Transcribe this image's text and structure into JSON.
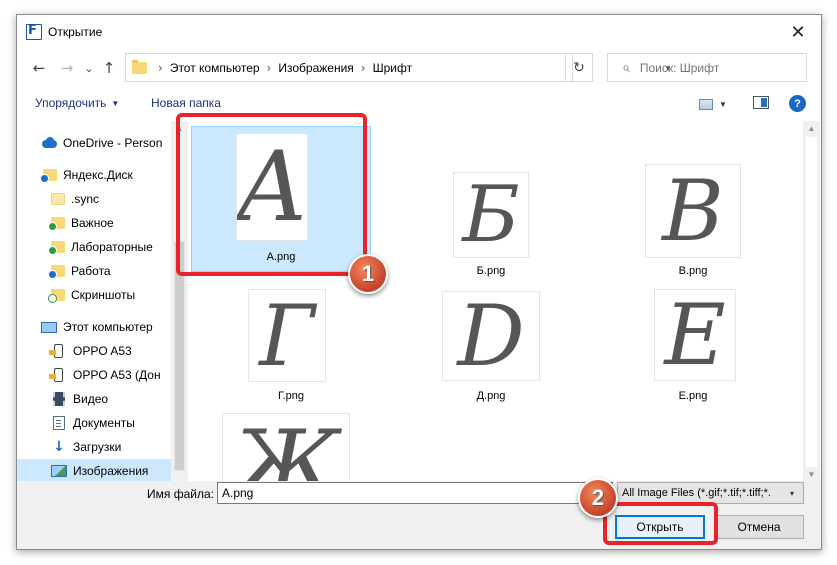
{
  "window": {
    "title": "Открытие",
    "close_label": "✕"
  },
  "nav": {
    "back": "←",
    "forward": "→",
    "recent": "⌄",
    "up": "↑",
    "breadcrumb": [
      "Этот компьютер",
      "Изображения",
      "Шрифт"
    ],
    "refresh": "↻",
    "search_placeholder": "Поиск: Шрифт",
    "search_icon": "⌕"
  },
  "toolbar": {
    "organize": "Упорядочить",
    "new_folder": "Новая папка",
    "help": "?"
  },
  "sidebar": {
    "items": [
      {
        "label": "OneDrive - Person",
        "icon": "onedrive-icon"
      },
      {
        "label": "Яндекс.Диск",
        "icon": "yandex-disk-icon"
      },
      {
        "label": ".sync",
        "icon": "folder-icon"
      },
      {
        "label": "Важное",
        "icon": "folder-synced-icon"
      },
      {
        "label": "Лабораторные",
        "icon": "folder-synced-icon"
      },
      {
        "label": "Работа",
        "icon": "folder-syncing-icon"
      },
      {
        "label": "Скриншоты",
        "icon": "folder-synced-icon"
      },
      {
        "label": "Этот компьютер",
        "icon": "computer-icon"
      },
      {
        "label": "OPPO A53",
        "icon": "phone-icon"
      },
      {
        "label": "OPPO A53 (Дон",
        "icon": "phone-icon"
      },
      {
        "label": "Видео",
        "icon": "video-icon"
      },
      {
        "label": "Документы",
        "icon": "documents-icon"
      },
      {
        "label": "Загрузки",
        "icon": "downloads-icon"
      },
      {
        "label": "Изображения",
        "icon": "pictures-icon"
      }
    ],
    "selected_index": 13
  },
  "files": [
    {
      "name": "А.png",
      "glyph": "A",
      "selected": true
    },
    {
      "name": "Б.png",
      "glyph": "Б",
      "selected": false
    },
    {
      "name": "В.png",
      "glyph": "B",
      "selected": false
    },
    {
      "name": "Г.png",
      "glyph": "Г",
      "selected": false
    },
    {
      "name": "Д.png",
      "glyph": "D",
      "selected": false
    },
    {
      "name": "Е.png",
      "glyph": "E",
      "selected": false
    },
    {
      "name": "",
      "glyph": "Ж",
      "selected": false
    }
  ],
  "bottom": {
    "filename_label": "Имя файла:",
    "filename_value": "А.png",
    "filter": "All Image Files (*.gif;*.tif;*.tiff;*.",
    "open": "Открыть",
    "cancel": "Отмена"
  },
  "annotations": {
    "marker1": "1",
    "marker2": "2",
    "color": "#e8232a"
  }
}
